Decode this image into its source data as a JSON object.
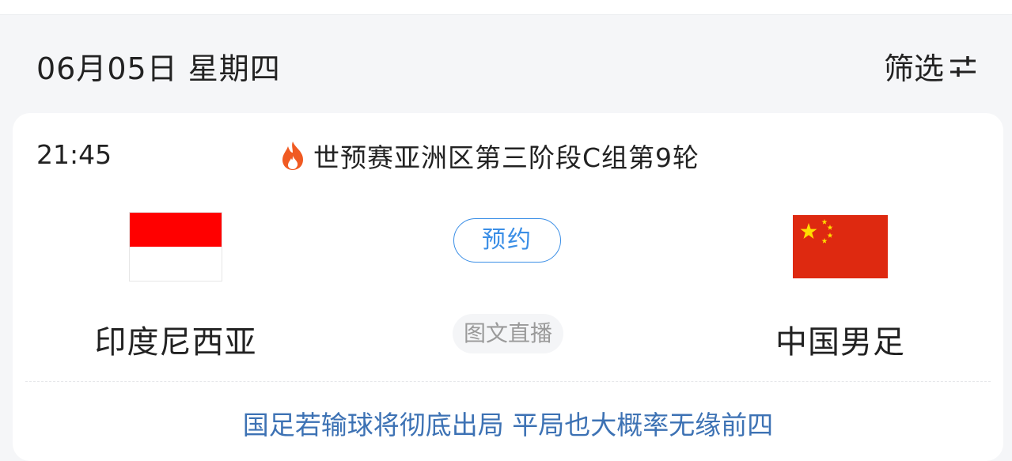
{
  "header": {
    "date": "06月05日  星期四",
    "filter_label": "筛选",
    "filter_icon": "sliders-icon"
  },
  "match": {
    "time": "21:45",
    "league_icon": "fire-icon",
    "league": "世预赛亚洲区第三阶段C组第9轮",
    "home": {
      "name": "印度尼西亚",
      "flag": "indonesia-flag"
    },
    "away": {
      "name": "中国男足",
      "flag": "china-flag"
    },
    "reserve_label": "预约",
    "live_label": "图文直播",
    "news": "国足若输球将彻底出局 平局也大概率无缘前四"
  },
  "colors": {
    "accent": "#3a8ee6",
    "news": "#3d72b4",
    "fire": "#f05a22",
    "indonesia_red": "#ff0000",
    "china_red": "#de2910",
    "china_star": "#ffde00"
  }
}
